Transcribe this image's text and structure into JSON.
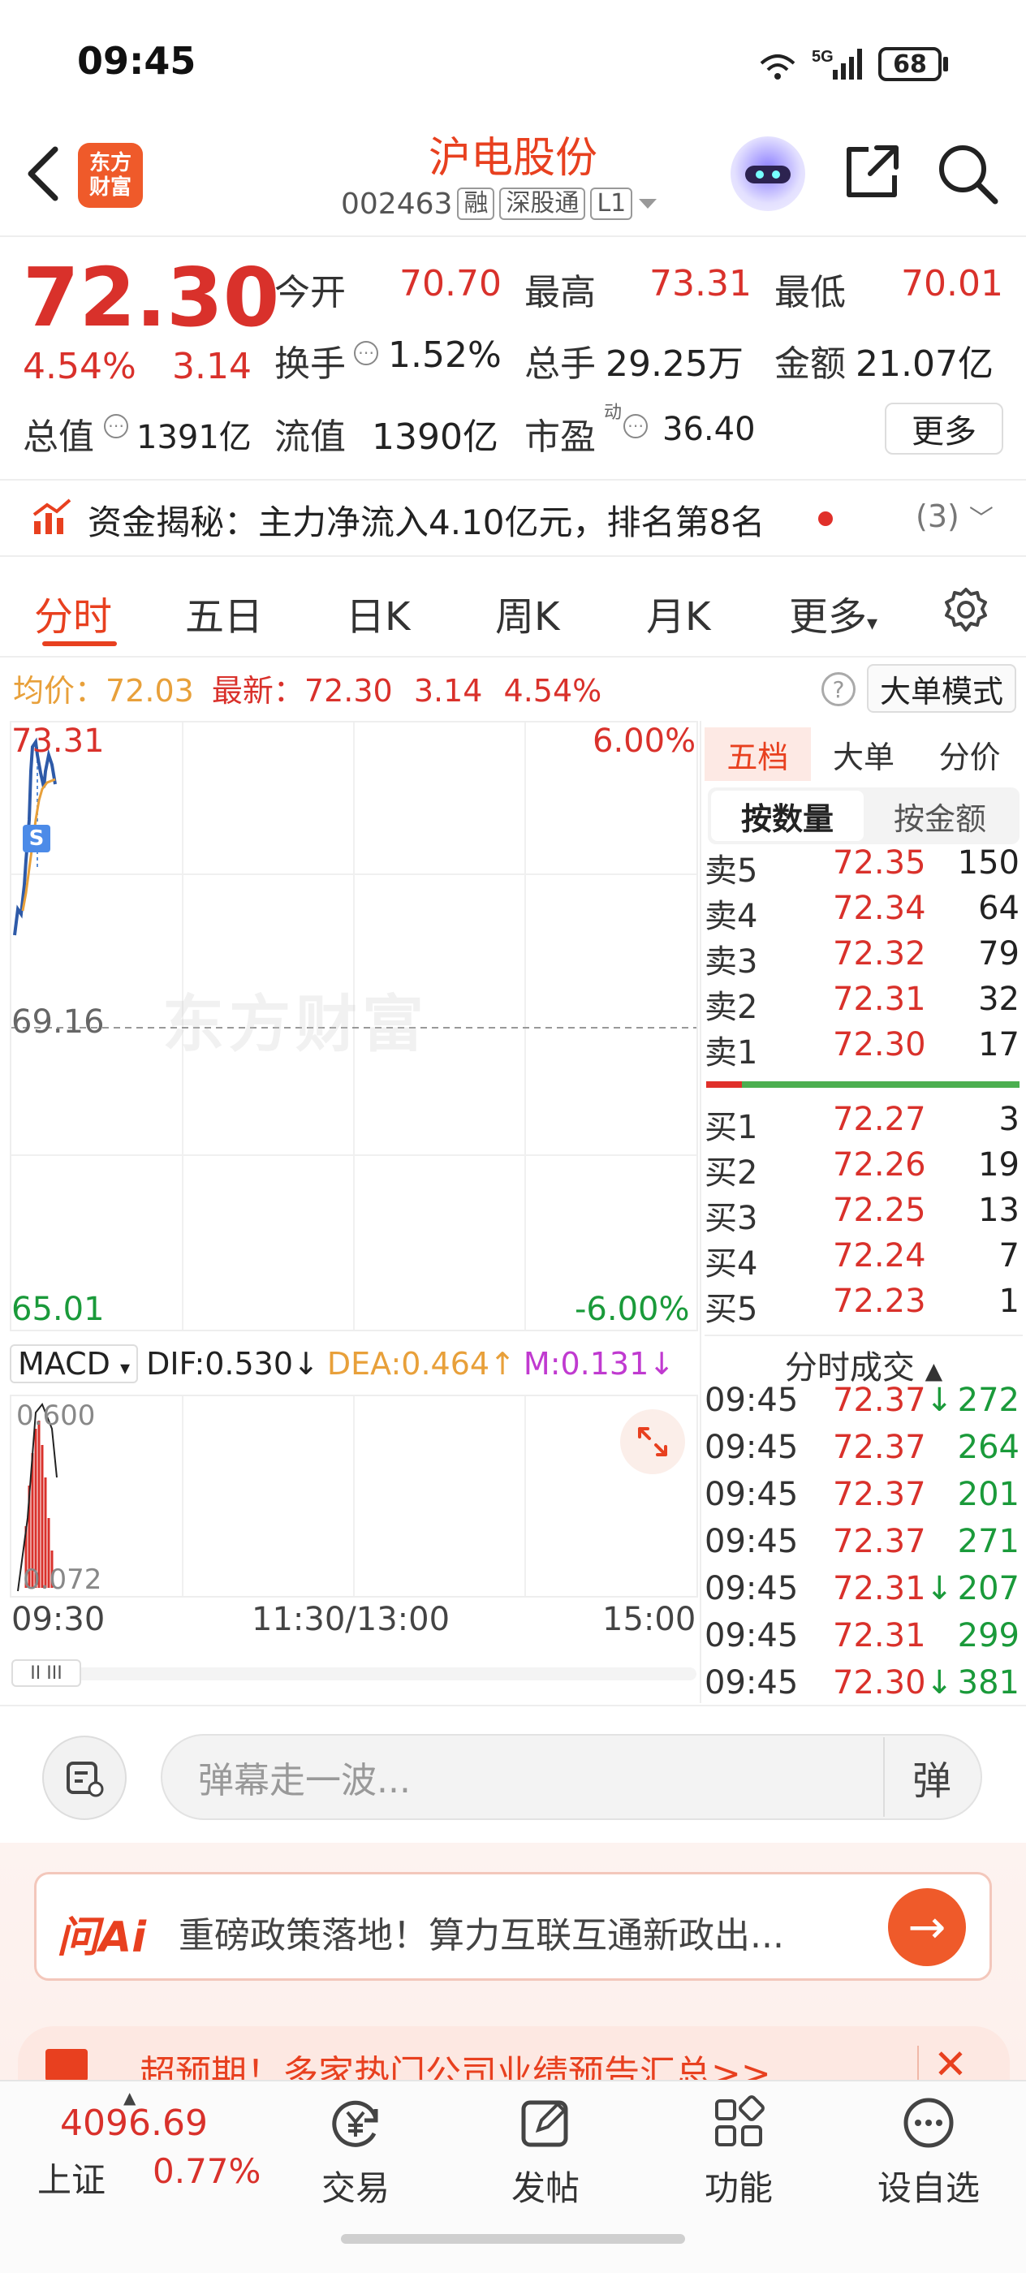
{
  "status_bar": {
    "time": "09:45",
    "network": "5G",
    "battery": "68"
  },
  "header": {
    "stock_name": "沪电股份",
    "stock_code": "002463",
    "tags": [
      "融",
      "深股通",
      "L1"
    ],
    "logo_text_1": "东方",
    "logo_text_2": "财富"
  },
  "quote": {
    "price": "72.30",
    "change_pct": "4.54%",
    "change": "3.14",
    "open_label": "今开",
    "open": "70.70",
    "high_label": "最高",
    "high": "73.31",
    "low_label": "最低",
    "low": "70.01",
    "turnover_label": "换手",
    "turnover": "1.52%",
    "volume_label": "总手",
    "volume": "29.25万",
    "amount_label": "金额",
    "amount": "21.07亿",
    "total_cap_label": "总值",
    "total_cap": "1391亿",
    "float_cap_label": "流值",
    "float_cap": "1390亿",
    "pe_label": "市盈",
    "pe_sup": "动",
    "pe": "36.40",
    "more_label": "更多"
  },
  "fund_flow": {
    "text": "资金揭秘：主力净流入4.10亿元，排名第8名",
    "count": "(3)"
  },
  "tabs": [
    "分时",
    "五日",
    "日K",
    "周K",
    "月K",
    "更多"
  ],
  "avg_row": {
    "avg_label": "均价：",
    "avg": "72.03",
    "latest_label": "最新：",
    "latest": "72.30",
    "change": "3.14",
    "pct": "4.54%"
  },
  "big_order_label": "大单模式",
  "chart": {
    "y_top": "73.31",
    "y_mid": "69.16",
    "y_bottom": "65.01",
    "pct_top": "6.00%",
    "pct_bottom": "-6.00%",
    "watermark": "东方财富",
    "marker": "S"
  },
  "macd": {
    "selector": "MACD",
    "dif": "DIF:0.530",
    "dea": "DEA:0.464",
    "m": "M:0.131",
    "top": "0.600",
    "bottom": "0.072"
  },
  "time_axis": [
    "09:30",
    "11:30/13:00",
    "15:00"
  ],
  "order_book": {
    "tabs": [
      "五档",
      "大单",
      "分价"
    ],
    "subtabs": [
      "按数量",
      "按金额"
    ],
    "asks": [
      {
        "label": "卖5",
        "price": "72.35",
        "vol": "150"
      },
      {
        "label": "卖4",
        "price": "72.34",
        "vol": "64"
      },
      {
        "label": "卖3",
        "price": "72.32",
        "vol": "79"
      },
      {
        "label": "卖2",
        "price": "72.31",
        "vol": "32"
      },
      {
        "label": "卖1",
        "price": "72.30",
        "vol": "17"
      }
    ],
    "bids": [
      {
        "label": "买1",
        "price": "72.27",
        "vol": "3"
      },
      {
        "label": "买2",
        "price": "72.26",
        "vol": "19"
      },
      {
        "label": "买3",
        "price": "72.25",
        "vol": "13"
      },
      {
        "label": "买4",
        "price": "72.24",
        "vol": "7"
      },
      {
        "label": "买5",
        "price": "72.23",
        "vol": "1"
      }
    ]
  },
  "trades": {
    "title": "分时成交",
    "rows": [
      {
        "time": "09:45",
        "price": "72.37",
        "arrow": "↓",
        "vol": "272"
      },
      {
        "time": "09:45",
        "price": "72.37",
        "arrow": "",
        "vol": "264"
      },
      {
        "time": "09:45",
        "price": "72.37",
        "arrow": "",
        "vol": "201"
      },
      {
        "time": "09:45",
        "price": "72.37",
        "arrow": "",
        "vol": "271"
      },
      {
        "time": "09:45",
        "price": "72.31",
        "arrow": "↓",
        "vol": "207"
      },
      {
        "time": "09:45",
        "price": "72.31",
        "arrow": "",
        "vol": "299"
      },
      {
        "time": "09:45",
        "price": "72.30",
        "arrow": "↓",
        "vol": "381"
      }
    ]
  },
  "danmaku": {
    "placeholder": "弹幕走一波...",
    "send": "弹"
  },
  "ai": {
    "logo": "问Ai",
    "text": "重磅政策落地！算力互联互通新政出..."
  },
  "promo": {
    "text": "超预期！多家热门公司业绩预告汇总>>"
  },
  "bottom_nav": {
    "index_value": "4096.69",
    "index_name": "上证",
    "index_pct": "0.77%",
    "items": [
      "交易",
      "发帖",
      "功能",
      "设自选"
    ]
  },
  "colors": {
    "up": "#d9312b",
    "down": "#1a9a3a",
    "accent": "#e8401f",
    "price_line": "#2e5aa8",
    "avg_line": "#e8a03a"
  }
}
